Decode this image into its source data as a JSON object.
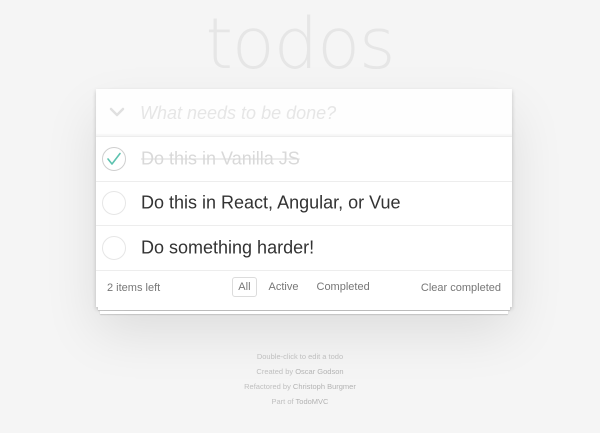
{
  "app": {
    "title": "todos"
  },
  "new_todo": {
    "placeholder": "What needs to be done?"
  },
  "todos": [
    {
      "label": "Do this in Vanilla JS",
      "completed": true
    },
    {
      "label": "Do this in React, Angular, or Vue",
      "completed": false
    },
    {
      "label": "Do something harder!",
      "completed": false
    }
  ],
  "footer": {
    "items_left": "2 items left",
    "filters": [
      "All",
      "Active",
      "Completed"
    ],
    "selected_filter": "All",
    "clear_completed": "Clear completed"
  },
  "info": {
    "line1": "Double-click to edit a todo",
    "line2_prefix": "Created by ",
    "line2_name": "Oscar Godson",
    "line3_prefix": "Refactored by ",
    "line3_name": "Christoph Burgmer",
    "line4_prefix": "Part of ",
    "line4_name": "TodoMVC"
  },
  "colors": {
    "title": "#e6e6e6",
    "check": "#5dc2af",
    "border": "#ededed",
    "background": "#f5f5f5"
  },
  "icons": {
    "toggle_all": "chevron-down-icon",
    "completed_toggle": "checkmark-icon"
  }
}
